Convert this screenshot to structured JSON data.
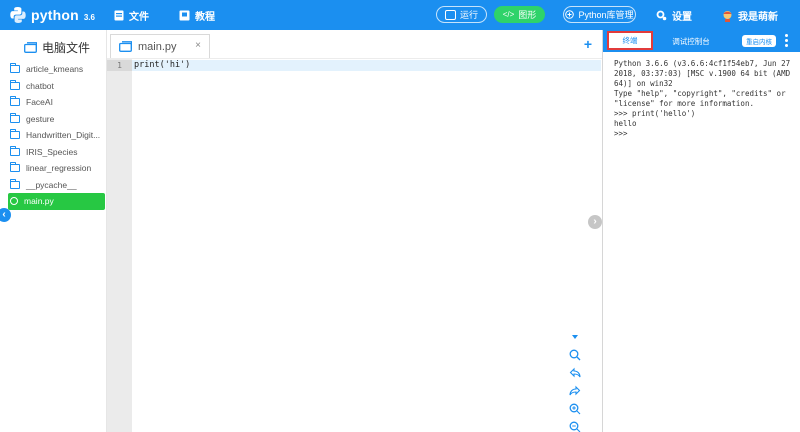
{
  "header": {
    "logo_text": "python",
    "logo_version": "3.6",
    "nav_file": "文件",
    "nav_tutorial": "教程",
    "run_label": "运行",
    "graphics_label": "图形",
    "library_label": "Python库管理",
    "settings_label": "设置",
    "user_label": "我是萌新"
  },
  "sidebar": {
    "title": "电脑文件",
    "items": [
      {
        "label": "article_kmeans",
        "type": "folder"
      },
      {
        "label": "chatbot",
        "type": "folder"
      },
      {
        "label": "FaceAI",
        "type": "folder"
      },
      {
        "label": "gesture",
        "type": "folder"
      },
      {
        "label": "Handwritten_Digit...",
        "type": "folder"
      },
      {
        "label": "IRIS_Species",
        "type": "folder"
      },
      {
        "label": "linear_regression",
        "type": "folder"
      },
      {
        "label": "__pycache__",
        "type": "folder"
      },
      {
        "label": "main.py",
        "type": "file",
        "active": true
      }
    ]
  },
  "editor": {
    "tab_label": "main.py",
    "line_number": "1",
    "code": "print('hi')"
  },
  "console": {
    "tab_terminal": "终端",
    "tab_debug": "调试控制台",
    "restart_label": "重启内核",
    "output": "Python 3.6.6 (v3.6.6:4cf1f54eb7, Jun 27 2018, 03:37:03) [MSC v.1900 64 bit (AMD64)] on win32\nType \"help\", \"copyright\", \"credits\" or \"license\" for more information.\n>>> print('hello')\nhello\n>>>"
  },
  "colors": {
    "accent": "#1b8ff0",
    "active_file": "#27c843",
    "run_green": "#2ed36a",
    "highlight_border": "#e23b3b"
  }
}
